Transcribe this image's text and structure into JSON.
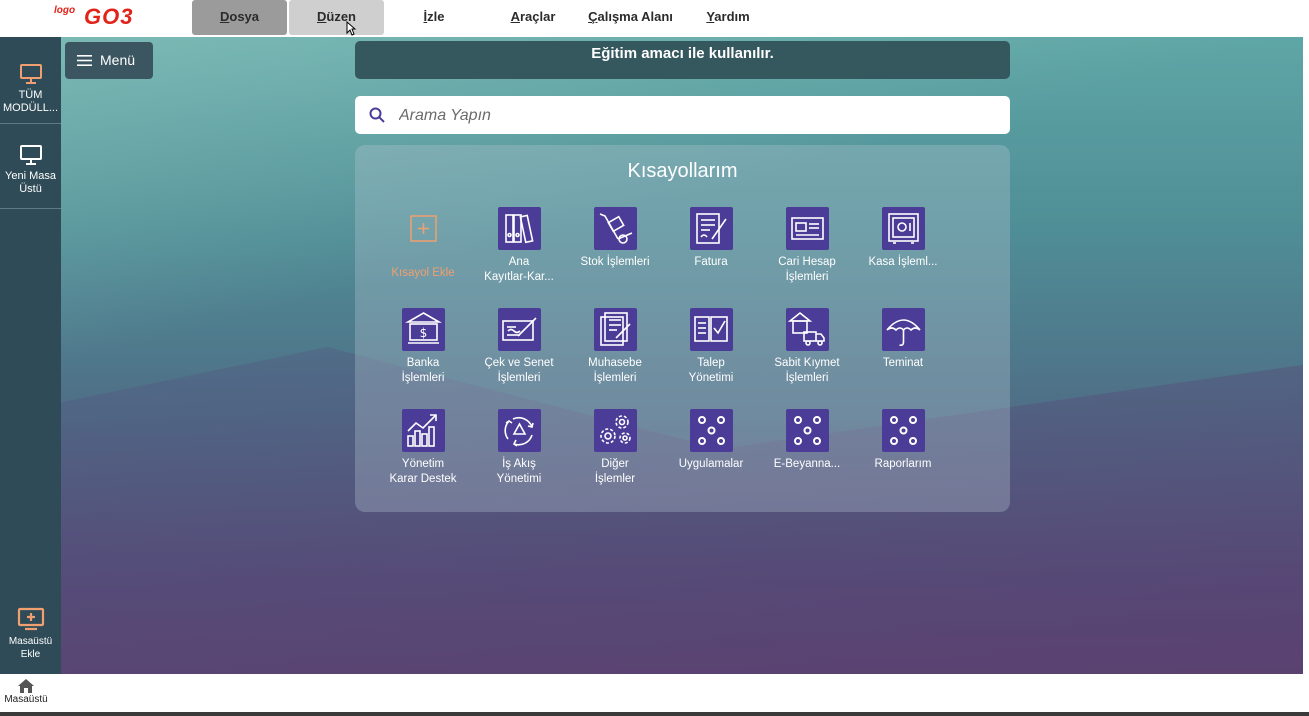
{
  "app": {
    "logo_small": "logo",
    "logo_main": "GO3"
  },
  "topmenu": [
    {
      "label_first": "D",
      "label_rest": "osya"
    },
    {
      "label_first": "D",
      "label_rest": "üzen"
    },
    {
      "label_first": "İ",
      "label_rest": "zle"
    },
    {
      "label_first": "A",
      "label_rest": "raçlar"
    },
    {
      "label_first": "Ç",
      "label_rest": "alışma Alanı"
    },
    {
      "label_first": "Y",
      "label_rest": "ardım"
    }
  ],
  "sidebar": {
    "items": [
      {
        "label_line1": "TÜM",
        "label_line2": "MODÜLL..."
      },
      {
        "label_line1": "Yeni Masa",
        "label_line2": "Üstü"
      }
    ],
    "add_desktop": {
      "label_line1": "Masaüstü",
      "label_line2": "Ekle"
    }
  },
  "menu_button": {
    "label": "Menü"
  },
  "banner": {
    "text": "Eğitim amacı ile kullanılır."
  },
  "search": {
    "placeholder": "Arama Yapın"
  },
  "shortcuts": {
    "title": "Kısayollarım",
    "add_label": "Kısayol Ekle",
    "tiles": [
      {
        "line1": "Ana",
        "line2": "Kayıtlar-Kar..."
      },
      {
        "line1": "Stok İşlemleri",
        "line2": ""
      },
      {
        "line1": "Fatura",
        "line2": ""
      },
      {
        "line1": "Cari Hesap",
        "line2": "İşlemleri"
      },
      {
        "line1": "Kasa İşleml...",
        "line2": ""
      },
      {
        "line1": "Banka",
        "line2": "İşlemleri"
      },
      {
        "line1": "Çek ve Senet",
        "line2": "İşlemleri"
      },
      {
        "line1": "Muhasebe",
        "line2": "İşlemleri"
      },
      {
        "line1": "Talep",
        "line2": "Yönetimi"
      },
      {
        "line1": "Sabit Kıymet",
        "line2": "İşlemleri"
      },
      {
        "line1": "Teminat",
        "line2": ""
      },
      {
        "line1": "Yönetim",
        "line2": "Karar Destek"
      },
      {
        "line1": "İş Akış",
        "line2": "Yönetimi"
      },
      {
        "line1": "Diğer",
        "line2": "İşlemler"
      },
      {
        "line1": "Uygulamalar",
        "line2": ""
      },
      {
        "line1": "E-Beyanna...",
        "line2": ""
      },
      {
        "line1": "Raporlarım",
        "line2": ""
      }
    ]
  },
  "bottombar": {
    "home_label": "Masaüstü"
  },
  "colors": {
    "accent": "#4b3d97",
    "sidebar": "#2f4b57",
    "brand": "#e2231a",
    "add_accent": "#f0a070"
  }
}
